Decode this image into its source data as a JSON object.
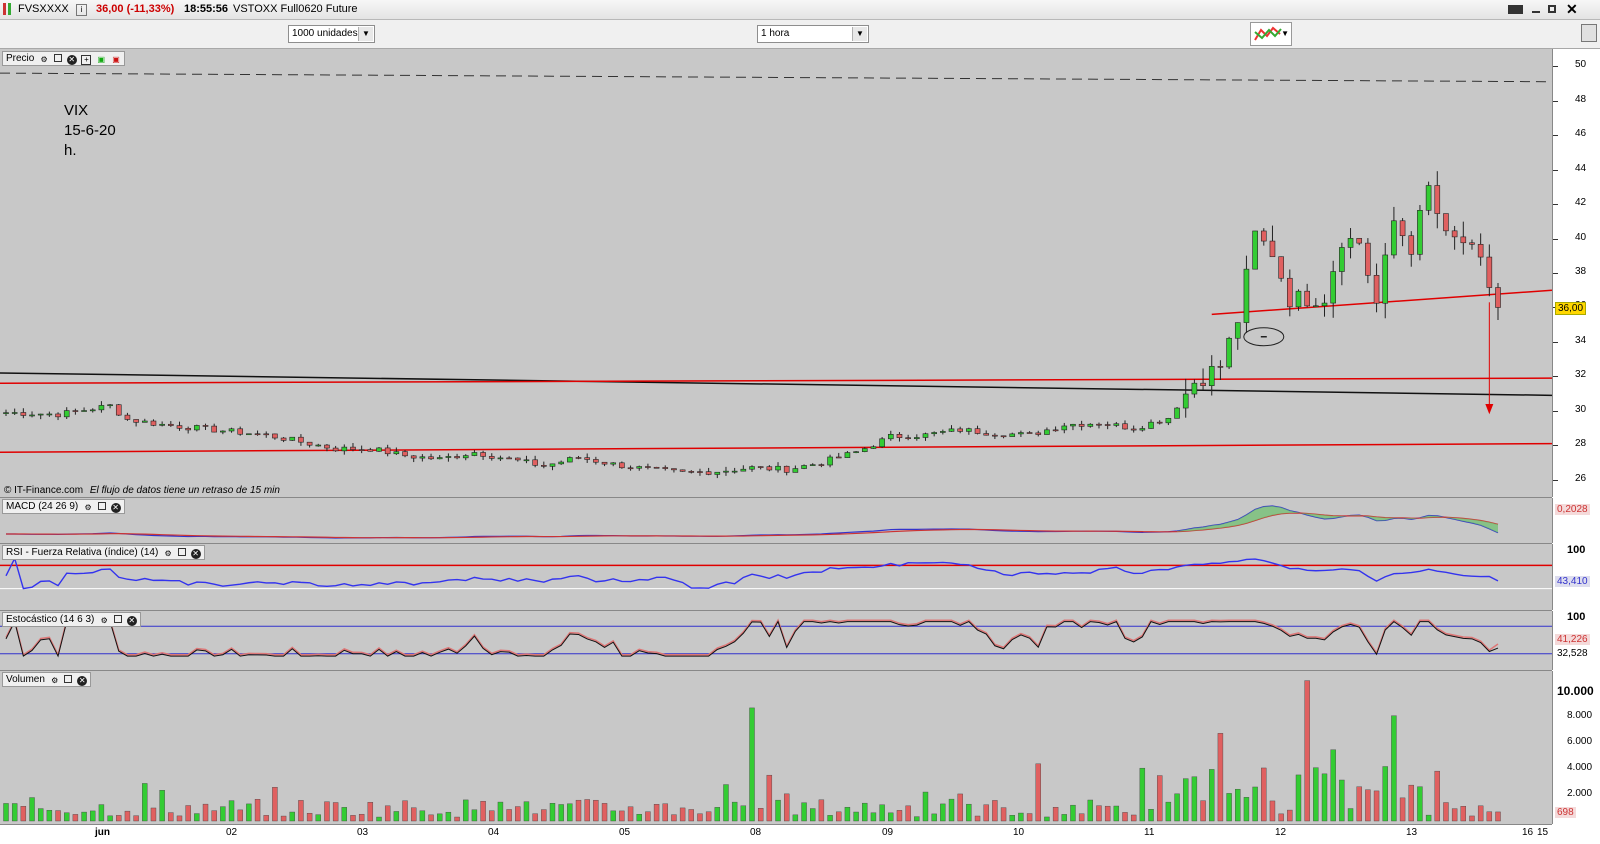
{
  "window": {
    "symbol": "FVSXXXX",
    "price": "36,00 (-11,33%)",
    "time": "18:55:56",
    "description": "VSTOXX Full0620 Future"
  },
  "toolbar": {
    "units": "1000 unidades",
    "interval": "1 hora"
  },
  "annotation": {
    "line1": "VIX",
    "line2": "15-6-20",
    "line3": "h."
  },
  "footer_note": {
    "source": "© IT-Finance.com",
    "delay": "El flujo de datos tiene un retraso de 15 min"
  },
  "panes": {
    "price": {
      "label": "Precio",
      "last": "36,00",
      "ticks": [
        "50",
        "48",
        "46",
        "44",
        "42",
        "40",
        "38",
        "36",
        "34",
        "32",
        "30",
        "28",
        "26"
      ]
    },
    "macd": {
      "label": "MACD (24 26 9)",
      "value": "0,2028"
    },
    "rsi": {
      "label": "RSI - Fuerza Relativa (índice) (14)",
      "top": "100",
      "value": "43,410"
    },
    "stoch": {
      "label": "Estocástico (14 6 3)",
      "top": "100",
      "value1": "41,226",
      "value2": "32,528"
    },
    "volume": {
      "label": "Volumen",
      "ticks": [
        "10.000",
        "8.000",
        "6.000",
        "4.000",
        "2.000"
      ],
      "value": "698"
    }
  },
  "x_axis": [
    "jun",
    "02",
    "03",
    "04",
    "05",
    "08",
    "09",
    "10",
    "11",
    "12",
    "13",
    "15",
    "16"
  ],
  "colors": {
    "up": "#33cc33",
    "down": "#e06060",
    "trend": "#e00000",
    "rsi": "#3333ee",
    "pane_bg": "#c8c8c8"
  },
  "chart_data": {
    "type": "candlestick",
    "title": "VIX 15-6-20 h.",
    "instrument": "VSTOXX Full0620 Future",
    "interval": "1 hora",
    "ylim": [
      25,
      51
    ],
    "x": [
      "jun",
      "02",
      "03",
      "04",
      "05",
      "08",
      "09",
      "10",
      "11",
      "12",
      "13",
      "15",
      "16"
    ],
    "anchors": [
      [
        0,
        29.9
      ],
      [
        6,
        29.8
      ],
      [
        12,
        30.3
      ],
      [
        14,
        29.5
      ],
      [
        18,
        29.2
      ],
      [
        22,
        29.0
      ],
      [
        26,
        28.8
      ],
      [
        30,
        28.6
      ],
      [
        34,
        28.2
      ],
      [
        38,
        27.8
      ],
      [
        42,
        27.8
      ],
      [
        46,
        27.4
      ],
      [
        50,
        27.2
      ],
      [
        54,
        27.6
      ],
      [
        58,
        27.2
      ],
      [
        62,
        26.8
      ],
      [
        66,
        27.3
      ],
      [
        70,
        26.9
      ],
      [
        74,
        26.6
      ],
      [
        78,
        26.4
      ],
      [
        82,
        26.5
      ],
      [
        86,
        26.7
      ],
      [
        90,
        26.6
      ],
      [
        94,
        27.0
      ],
      [
        98,
        27.6
      ],
      [
        102,
        28.5
      ],
      [
        106,
        28.6
      ],
      [
        110,
        28.9
      ],
      [
        114,
        28.7
      ],
      [
        118,
        28.6
      ],
      [
        122,
        29.2
      ],
      [
        126,
        29.3
      ],
      [
        130,
        29.0
      ],
      [
        134,
        29.6
      ],
      [
        137,
        31.7
      ],
      [
        140,
        32.6
      ],
      [
        142,
        35.3
      ],
      [
        144,
        40.2
      ],
      [
        146,
        39.2
      ],
      [
        148,
        36.5
      ],
      [
        152,
        36.6
      ],
      [
        154,
        40.0
      ],
      [
        156,
        39.8
      ],
      [
        158,
        36.2
      ],
      [
        160,
        41.0
      ],
      [
        162,
        39.5
      ],
      [
        164,
        42.9
      ],
      [
        166,
        40.0
      ],
      [
        168,
        39.8
      ],
      [
        170,
        38.5
      ],
      [
        172,
        36.0
      ]
    ],
    "macd_last": 0.2028,
    "rsi_last": 43.41,
    "stochastic_last": [
      41.226,
      32.528
    ],
    "volume_last": 698,
    "trendlines": [
      "black descending resistance",
      "red horizontal near 31.8",
      "red horizontal near 28",
      "red ascending support near 36.5"
    ]
  }
}
